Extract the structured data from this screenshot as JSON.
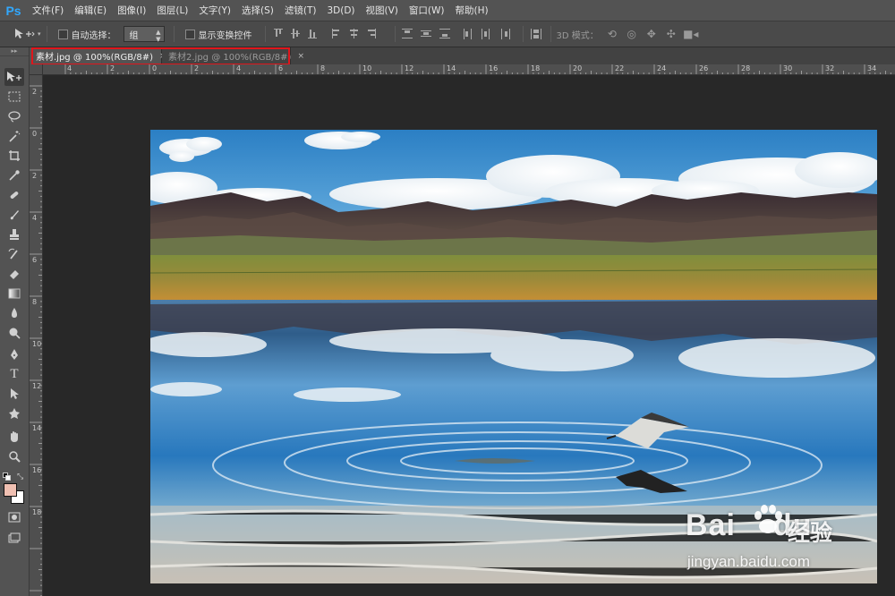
{
  "app": {
    "logo": "Ps"
  },
  "menu": [
    "文件(F)",
    "编辑(E)",
    "图像(I)",
    "图层(L)",
    "文字(Y)",
    "选择(S)",
    "滤镜(T)",
    "3D(D)",
    "视图(V)",
    "窗口(W)",
    "帮助(H)"
  ],
  "options": {
    "auto_select_label": "自动选择：",
    "auto_select_value": "组",
    "show_transform_label": "显示变换控件",
    "mode_3d_label": "3D 模式：",
    "icons": [
      "move-tool-icon",
      "align-top-icon",
      "align-vcenter-icon",
      "align-bottom-icon",
      "align-left-icon",
      "align-hcenter-icon",
      "align-right-icon",
      "distribute-icons",
      "auto-align-icon",
      "3d-rotate-icon",
      "3d-roll-icon",
      "3d-pan-icon",
      "3d-slide-icon",
      "3d-scale-icon"
    ]
  },
  "tabs": [
    {
      "label": "素材.jpg @ 100%(RGB/8#)",
      "close": "×",
      "active": true
    },
    {
      "label": "素材2.jpg @ 100%(RGB/8#)",
      "close": "×",
      "active": false
    }
  ],
  "highlight_color": "#e0161c",
  "ruler_top": [
    "4",
    "2",
    "0",
    "2",
    "4",
    "6",
    "8",
    "10",
    "12",
    "14",
    "16",
    "18",
    "20",
    "22",
    "24",
    "26",
    "28",
    "30",
    "32",
    "34"
  ],
  "ruler_left": [
    "2",
    "0",
    "2",
    "4",
    "6",
    "8",
    "10",
    "12",
    "14",
    "16",
    "18"
  ],
  "colors": {
    "foreground": "#f0c0b2",
    "background": "#ffffff"
  },
  "watermark": {
    "brand": "Bai",
    "brand_suffix": "du",
    "jingyan": "经验",
    "url": "jingyan.baidu.com"
  }
}
